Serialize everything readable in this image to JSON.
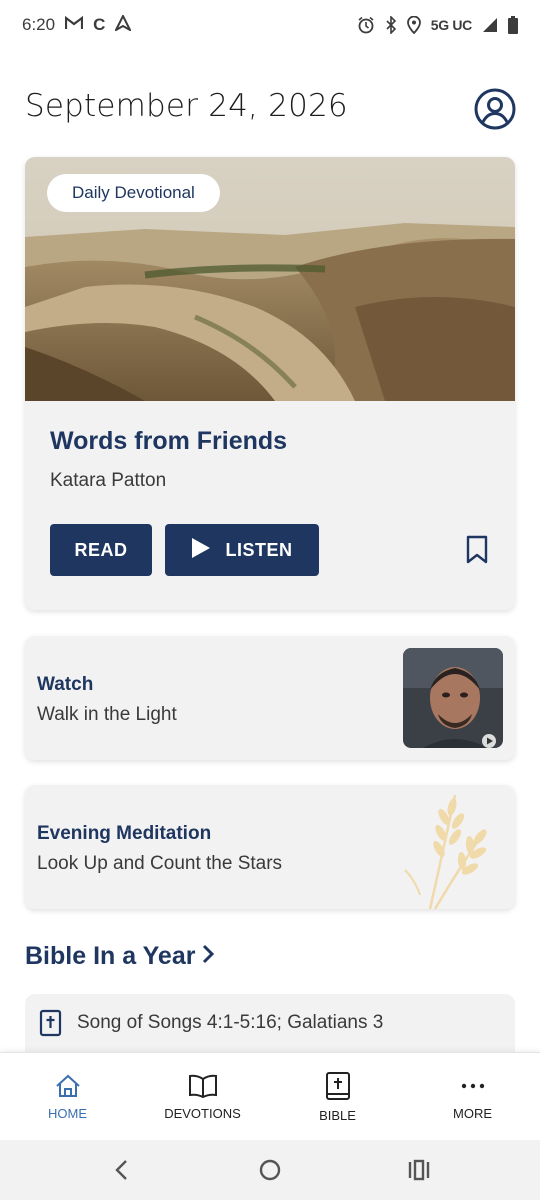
{
  "status_bar": {
    "time": "6:20",
    "left_icons": [
      "gmail-icon",
      "c-app-icon",
      "arrow-app-icon"
    ],
    "network": "5G UC",
    "right_icons": [
      "alarm-icon",
      "bluetooth-icon",
      "location-icon",
      "signal-icon",
      "battery-icon"
    ]
  },
  "header": {
    "date": "September 24, 2026",
    "profile_icon": "profile-icon"
  },
  "hero": {
    "badge": "Daily Devotional",
    "title": "Words from Friends",
    "author": "Katara Patton",
    "read_label": "READ",
    "listen_label": "LISTEN",
    "bookmark_icon": "bookmark-icon"
  },
  "watch": {
    "title": "Watch",
    "subtitle": "Walk in the Light"
  },
  "evening": {
    "title": "Evening Meditation",
    "subtitle": "Look Up and Count the Stars"
  },
  "bible_year": {
    "heading": "Bible In a Year",
    "reading": "Song of Songs 4:1-5:16; Galatians 3"
  },
  "bottom_nav": {
    "items": [
      {
        "label": "HOME",
        "icon": "home-icon",
        "active": true
      },
      {
        "label": "DEVOTIONS",
        "icon": "book-open-icon",
        "active": false
      },
      {
        "label": "BIBLE",
        "icon": "bible-icon",
        "active": false
      },
      {
        "label": "MORE",
        "icon": "more-icon",
        "active": false
      }
    ]
  },
  "colors": {
    "primary": "#1f3660",
    "active_nav": "#3a6fb0",
    "card_bg": "#f2f2f3"
  }
}
